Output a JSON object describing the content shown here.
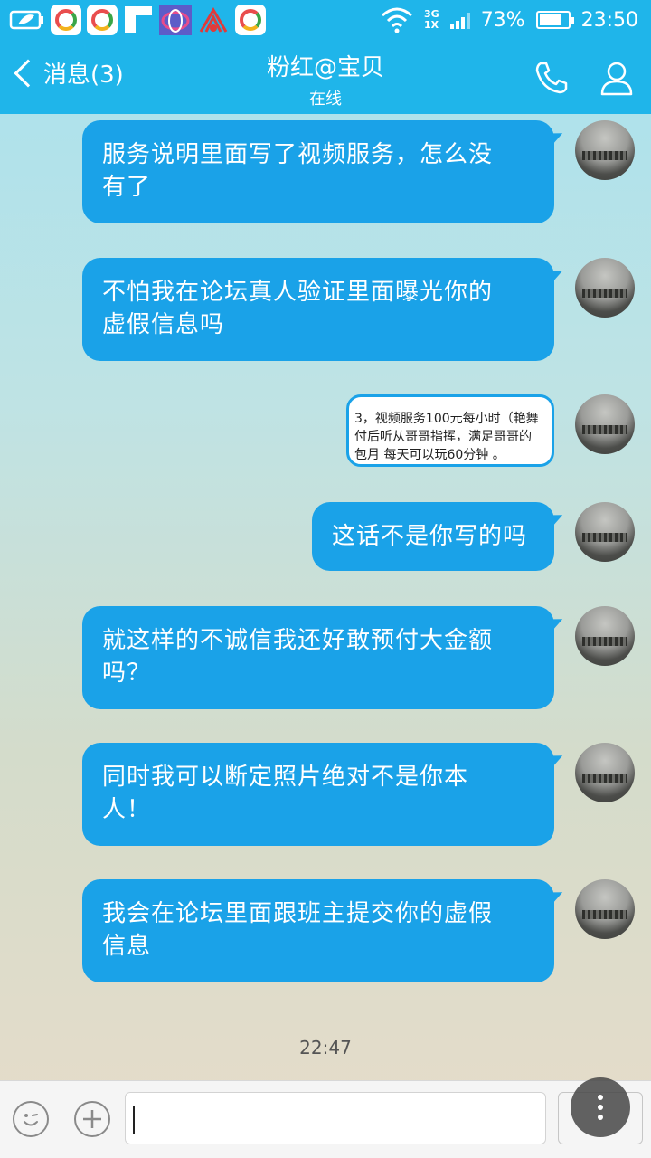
{
  "status_bar": {
    "network_top": "3G",
    "network_bottom": "1X",
    "battery": "73%",
    "time": "23:50"
  },
  "header": {
    "back_label": "消息(3)",
    "title": "粉红@宝贝",
    "subtitle": "在线"
  },
  "messages": [
    {
      "lines": [
        "服务说明里面写了视频服务，怎么没",
        "有了"
      ]
    },
    {
      "lines": [
        "不怕我在论坛真人验证里面曝光你的",
        "虚假信息吗"
      ]
    },
    {
      "shared_lines": [
        "3，视频服务100元每小时（艳舞",
        "付后听从哥哥指挥，满足哥哥的",
        "包月 每天可以玩60分钟 。"
      ]
    },
    {
      "lines": [
        "这话不是你写的吗"
      ]
    },
    {
      "lines": [
        "就这样的不诚信我还好敢预付大金额",
        "吗？"
      ]
    },
    {
      "lines": [
        "同时我可以断定照片绝对不是你本",
        "人！"
      ]
    },
    {
      "lines": [
        "我会在论坛里面跟班主提交你的虚假",
        "信息"
      ]
    }
  ],
  "timestamp": "22:47",
  "colors": {
    "accent": "#1fb5ea",
    "bubble": "#1aa2e8"
  },
  "icons": {
    "back": "chevron-left-icon",
    "call": "phone-icon",
    "profile": "person-icon",
    "emoji": "smiley-icon",
    "plus": "plus-icon",
    "float": "more-vertical-icon"
  }
}
